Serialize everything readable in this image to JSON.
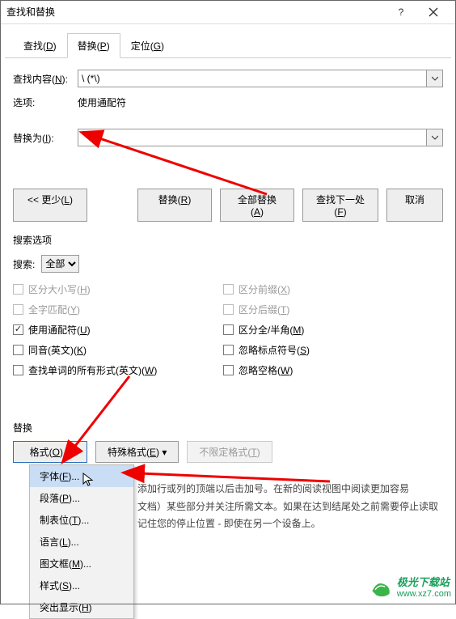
{
  "titlebar": {
    "title": "查找和替换"
  },
  "tabs": {
    "find": "查找(D)",
    "replace": "替换(P)",
    "goto": "定位(G)"
  },
  "findLabel": "查找内容(N):",
  "findValue": "\\ (*\\)",
  "optionsLabel": "选项:",
  "optionsValue": "使用通配符",
  "replaceLabel": "替换为(I):",
  "replaceValue": "",
  "buttons": {
    "less": "<< 更少(L)",
    "replace": "替换(R)",
    "replaceAll": "全部替换(A)",
    "findNext": "查找下一处(F)",
    "cancel": "取消"
  },
  "searchOptionsTitle": "搜索选项",
  "searchLabel": "搜索:",
  "searchSelect": "全部",
  "checks": {
    "matchCase": "区分大小写(H)",
    "prefix": "区分前缀(X)",
    "wholeWord": "全字匹配(Y)",
    "suffix": "区分后缀(T)",
    "wildcards": "使用通配符(U)",
    "fullHalf": "区分全/半角(M)",
    "soundsLike": "同音(英文)(K)",
    "ignorePunct": "忽略标点符号(S)",
    "allWordForms": "查找单词的所有形式(英文)(W)",
    "ignoreSpace": "忽略空格(W)"
  },
  "replaceSection": {
    "title": "替换",
    "formatBtn": "格式(O)",
    "specialBtn": "特殊格式(E)",
    "noFormatBtn": "不限定格式(T)"
  },
  "menu": {
    "font": "字体(F)...",
    "paragraph": "段落(P)...",
    "tabs": "制表位(T)...",
    "language": "语言(L)...",
    "frame": "图文框(M)...",
    "style": "样式(S)...",
    "highlight": "突出显示(H)"
  },
  "bgText": {
    "l1": "添加行或列的顶端以后击加号。在新的阅读视图中阅读更加容易",
    "l2": "文档）某些部分并关注所需文本。如果在达到结尾处之前需要停止读取",
    "l3": "记住您的停止位置 - 即使在另一个设备上。"
  },
  "watermark": {
    "name": "极光下载站",
    "url": "www.xz7.com"
  }
}
